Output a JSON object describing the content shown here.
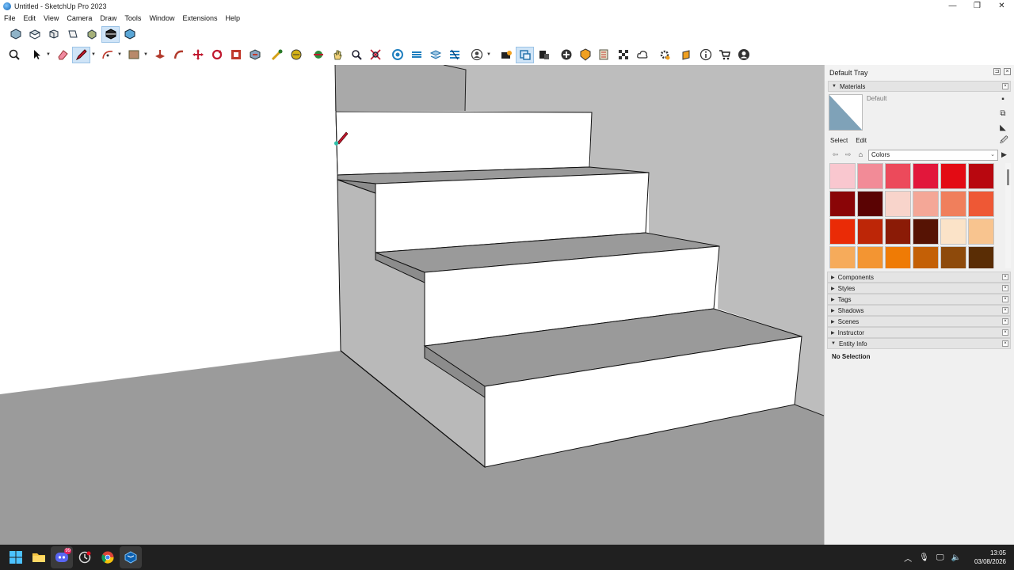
{
  "window": {
    "title": "Untitled - SketchUp Pro 2023",
    "controls": {
      "minimize": "—",
      "maximize": "❐",
      "close": "✕"
    }
  },
  "menu": [
    "File",
    "Edit",
    "View",
    "Camera",
    "Draw",
    "Tools",
    "Window",
    "Extensions",
    "Help"
  ],
  "toolbar_views": [
    "iso-view-icon",
    "top-view-icon",
    "front-view-icon",
    "right-view-icon",
    "back-view-icon",
    "left-view-icon",
    "bottom-view-icon"
  ],
  "toolbar_main": [
    "zoom-icon",
    "select-icon",
    "eraser-icon",
    "pencil-line-icon",
    "arc-icon",
    "rectangle-icon",
    "push-pull-icon",
    "follow-me-icon",
    "move-icon",
    "rotate-icon",
    "scale-icon",
    "offset-icon",
    "tape-measure-icon",
    "paint-bucket-icon",
    "orbit-icon",
    "pan-icon",
    "zoom-window-icon",
    "zoom-extents-icon",
    "section-plane-icon",
    "section-cuts-icon",
    "section-fill-icon",
    "section-display-icon",
    "user-avatar-icon",
    "warehouse-icon",
    "extension-warehouse-icon",
    "layout-icon",
    "trimble-connect-icon",
    "add-location-icon",
    "sandbox-icon",
    "solid-tools-icon",
    "cloud-icon",
    "settings-icon",
    "extension-manager-icon",
    "info-icon",
    "cart-icon",
    "account-icon"
  ],
  "tray": {
    "title": "Default Tray",
    "materials": {
      "label": "Materials",
      "current_name": "Default",
      "tabs": [
        "Select",
        "Edit"
      ],
      "library": "Colors",
      "swatches": [
        "#f9c7cf",
        "#f28b97",
        "#ec4a5b",
        "#e2173b",
        "#e30b14",
        "#b8070f",
        "#8a0507",
        "#5a0303",
        "#f8d4cb",
        "#f4a797",
        "#f07f5c",
        "#ee5835",
        "#ea2b06",
        "#bd2607",
        "#8b1b06",
        "#561304",
        "#fbe3c8",
        "#f8c48f",
        "#f6ab5b",
        "#f39532",
        "#ef7b05",
        "#c46006",
        "#8e4a0b",
        "#5a2d05"
      ]
    },
    "panels": [
      "Components",
      "Styles",
      "Tags",
      "Shadows",
      "Scenes",
      "Instructor",
      "Entity Info"
    ],
    "entity_info": "No Selection"
  },
  "taskbar": {
    "discord_badge": "99",
    "time": "13:05",
    "date": "03/08/2026"
  }
}
